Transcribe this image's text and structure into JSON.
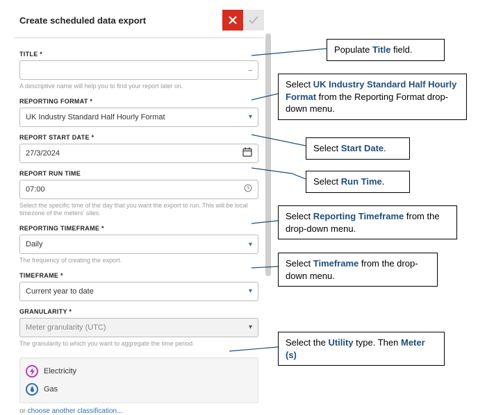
{
  "panel": {
    "title": "Create scheduled data export"
  },
  "form": {
    "title_label": "TITLE *",
    "title_value": "",
    "title_hint": "A descriptive name will help you to find your report later on.",
    "format_label": "REPORTING FORMAT *",
    "format_value": "UK Industry Standard Half Hourly Format",
    "start_label": "REPORT START DATE *",
    "start_value": "27/3/2024",
    "runtime_label": "REPORT RUN TIME",
    "runtime_value": "07:00",
    "runtime_hint": "Select the specific time of the day that you want the export to run. This will be local timezone of the meters' sites.",
    "rtf_label": "REPORTING TIMEFRAME *",
    "rtf_value": "Daily",
    "rtf_hint": "The frequency of creating the export.",
    "tf_label": "TIMEFRAME *",
    "tf_value": "Current year to date",
    "gran_label": "GRANULARITY *",
    "gran_value": "Meter granularity (UTC)",
    "gran_hint": "The granularity to which you want to aggregate the time period."
  },
  "utilities": {
    "electricity": "Electricity",
    "gas": "Gas",
    "link_pre": "or ",
    "link_text": "choose another classification..."
  },
  "callouts": {
    "c1a": "Populate ",
    "c1b": "Title",
    "c1c": " field.",
    "c2a": "Select ",
    "c2b": "UK Industry Standard Half Hourly Format",
    "c2c": " from the Reporting Format drop-down menu.",
    "c3a": "Select ",
    "c3b": "Start Date",
    "c3c": ".",
    "c4a": "Select ",
    "c4b": "Run Time",
    "c4c": ".",
    "c5a": "Select ",
    "c5b": "Reporting Timeframe",
    "c5c": " from the drop-down menu.",
    "c6a": "Select ",
    "c6b": "Timeframe",
    "c6c": " from the drop-down menu.",
    "c7a": "Select the ",
    "c7b": "Utility",
    "c7c": " type. Then ",
    "c7d": "Meter (s)"
  }
}
